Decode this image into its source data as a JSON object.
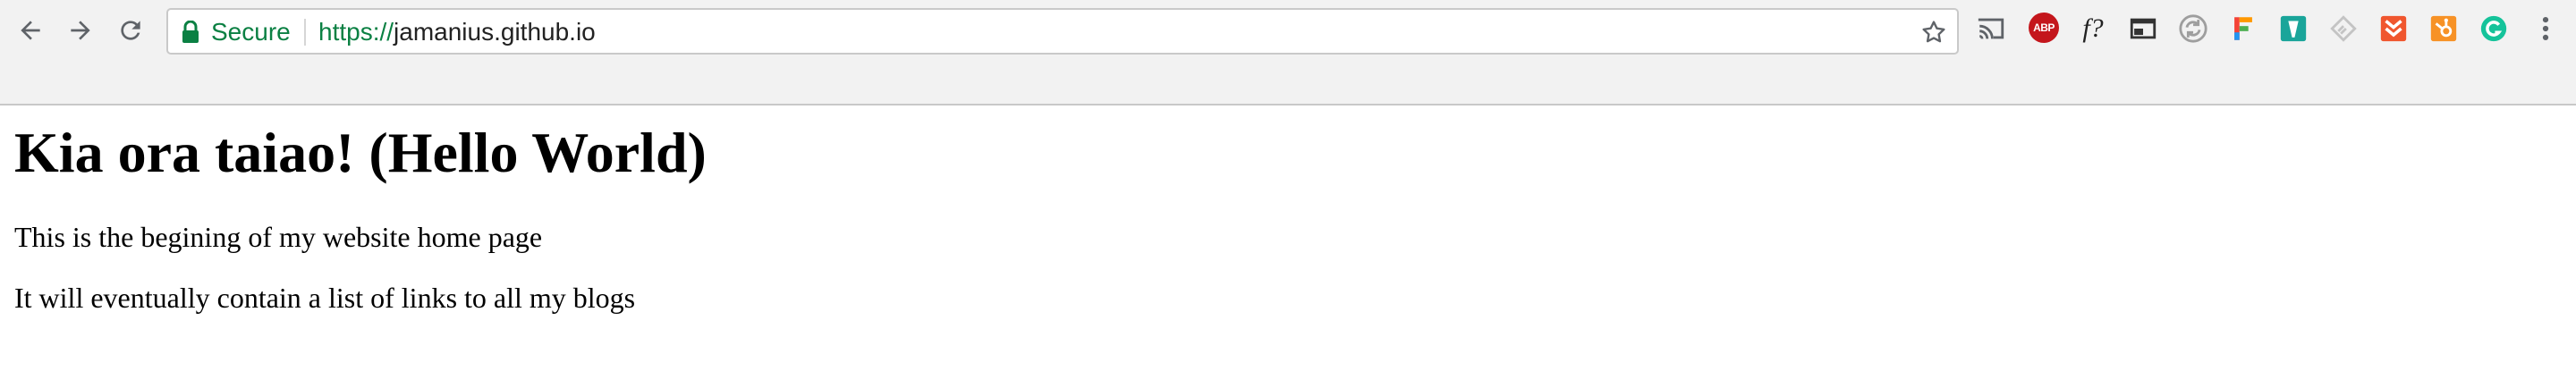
{
  "browser": {
    "omnibox": {
      "security_label": "Secure",
      "url_scheme": "https://",
      "url_host": "jamanius.github.io"
    },
    "extensions": [
      "cast-icon",
      "adblock-plus-icon",
      "font-finder-icon",
      "window-icon",
      "circle-arrows-icon",
      "fontface-ninja-icon",
      "boomerang-icon",
      "feedly-icon",
      "chevrons-icon",
      "hubspot-icon",
      "grammarly-icon",
      "more-menu-icon"
    ],
    "extension_text": {
      "abp": "ABP",
      "font_finder": "f?"
    },
    "colors": {
      "secure_green": "#0b8043",
      "chrome_background": "#f2f2f2"
    }
  },
  "page": {
    "title": "Kia ora taiao! (Hello World)",
    "paragraphs": [
      "This is the begining of my website home page",
      "It will eventually contain a list of links to all my blogs"
    ]
  }
}
